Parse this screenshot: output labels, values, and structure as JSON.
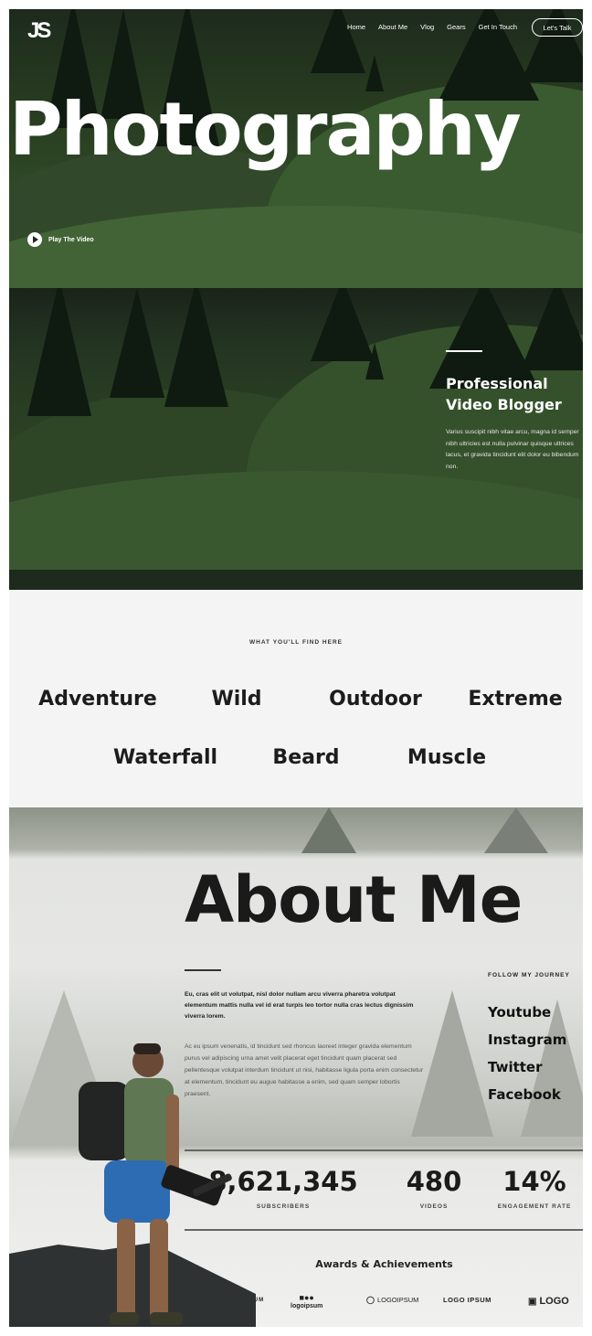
{
  "header": {
    "logo": "JS",
    "nav": [
      "Home",
      "About Me",
      "Vlog",
      "Gears",
      "Get In Touch"
    ],
    "cta_label": "Let's Talk"
  },
  "hero": {
    "title": "Photography",
    "play_label": "Play The Video"
  },
  "video_section": {
    "title_line1": "Professional",
    "title_line2": "Video Blogger",
    "description": "Varius suscipit nibh vitae arcu, magna id semper nibh ultricies est nulla pulvinar quisque ultrices lacus, et gravida tincidunt elit dolor eu bibendum non."
  },
  "categories": {
    "label": "WHAT YOU'LL FIND HERE",
    "row1": [
      "Adventure",
      "Wild",
      "Outdoor",
      "Extreme"
    ],
    "row2": [
      "Waterfall",
      "Beard",
      "Muscle"
    ]
  },
  "about": {
    "title": "About Me",
    "intro": "Eu, cras elit ut volutpat, nisl dolor nullam arcu viverra pharetra volutpat elementum mattis nulla vel id erat turpis leo tortor nulla cras lectus dignissim viverra lorem.",
    "body": "Ac eu ipsum venenatis, id tincidunt sed rhoncus laoreet integer gravida elementum purus vel adipiscing urna amet velit placerat eget tincidunt quam placerat sed pellentesque volutpat interdum tincidunt ut nisi, habitasse ligula porta enim consectetur at elementum, tincidunt eu augue habitasse a enim, sed quam semper lobortis praesent.",
    "follow_label": "FOLLOW MY JOURNEY",
    "socials": [
      "Youtube",
      "Instagram",
      "Twitter",
      "Facebook"
    ]
  },
  "stats": [
    {
      "value": "8,621,345",
      "label": "SUBSCRIBERS"
    },
    {
      "value": "480",
      "label": "VIDEOS"
    },
    {
      "value": "14%",
      "label": "ENGAGEMENT RATE"
    }
  ],
  "awards": {
    "title": "Awards & Achievements",
    "logos": [
      "LOGOIPSUM",
      "logoipsum",
      "LOGOIPSUM",
      "LOGO IPSUM",
      "LOGO"
    ]
  }
}
